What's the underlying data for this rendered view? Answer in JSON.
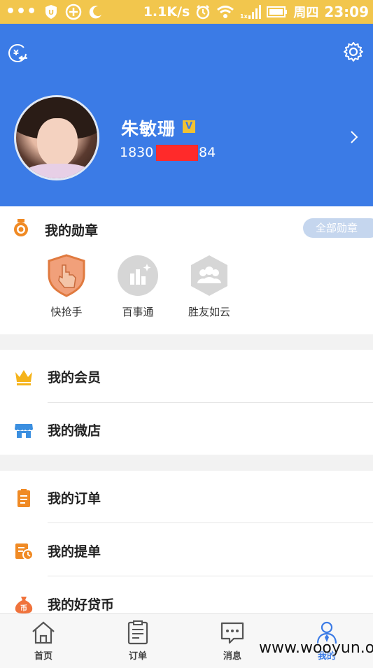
{
  "status_bar": {
    "speed": "1.1K/s",
    "day": "周四",
    "time": "23:09",
    "icons": [
      "more-dots-icon",
      "shield-icon",
      "plus-circle-icon",
      "moon-icon",
      "alarm-icon",
      "wifi-icon",
      "signal-icon",
      "battery-icon"
    ]
  },
  "header": {
    "left_icon": "currency-exchange-icon",
    "right_icon": "gear-icon",
    "user": {
      "name": "朱敏珊",
      "verified_badge": "V",
      "phone_prefix": "1830",
      "phone_suffix": "84"
    }
  },
  "medals": {
    "title": "我的勋章",
    "all_label": "全部勋章",
    "items": [
      {
        "label": "快抢手",
        "icon": "hand-shield-icon",
        "earned": true
      },
      {
        "label": "百事通",
        "icon": "chart-sparkle-icon",
        "earned": false
      },
      {
        "label": "胜友如云",
        "icon": "group-hexagon-icon",
        "earned": false
      }
    ]
  },
  "section1": [
    {
      "label": "我的会员",
      "icon": "crown-icon"
    },
    {
      "label": "我的微店",
      "icon": "shop-icon"
    }
  ],
  "section2": [
    {
      "label": "我的订单",
      "icon": "clipboard-icon"
    },
    {
      "label": "我的提单",
      "icon": "bill-icon"
    },
    {
      "label": "我的好贷币",
      "icon": "money-bag-icon"
    }
  ],
  "tabs": [
    {
      "label": "首页",
      "icon": "home-icon"
    },
    {
      "label": "订单",
      "icon": "document-icon"
    },
    {
      "label": "消息",
      "icon": "chat-icon"
    },
    {
      "label": "我的",
      "icon": "person-icon",
      "active": true
    }
  ],
  "watermark": "www.wooyun.org",
  "colors": {
    "status_bar": "#f2c64d",
    "header": "#3b7be6",
    "accent_orange": "#f08a24",
    "active_tab": "#3b7be6"
  }
}
